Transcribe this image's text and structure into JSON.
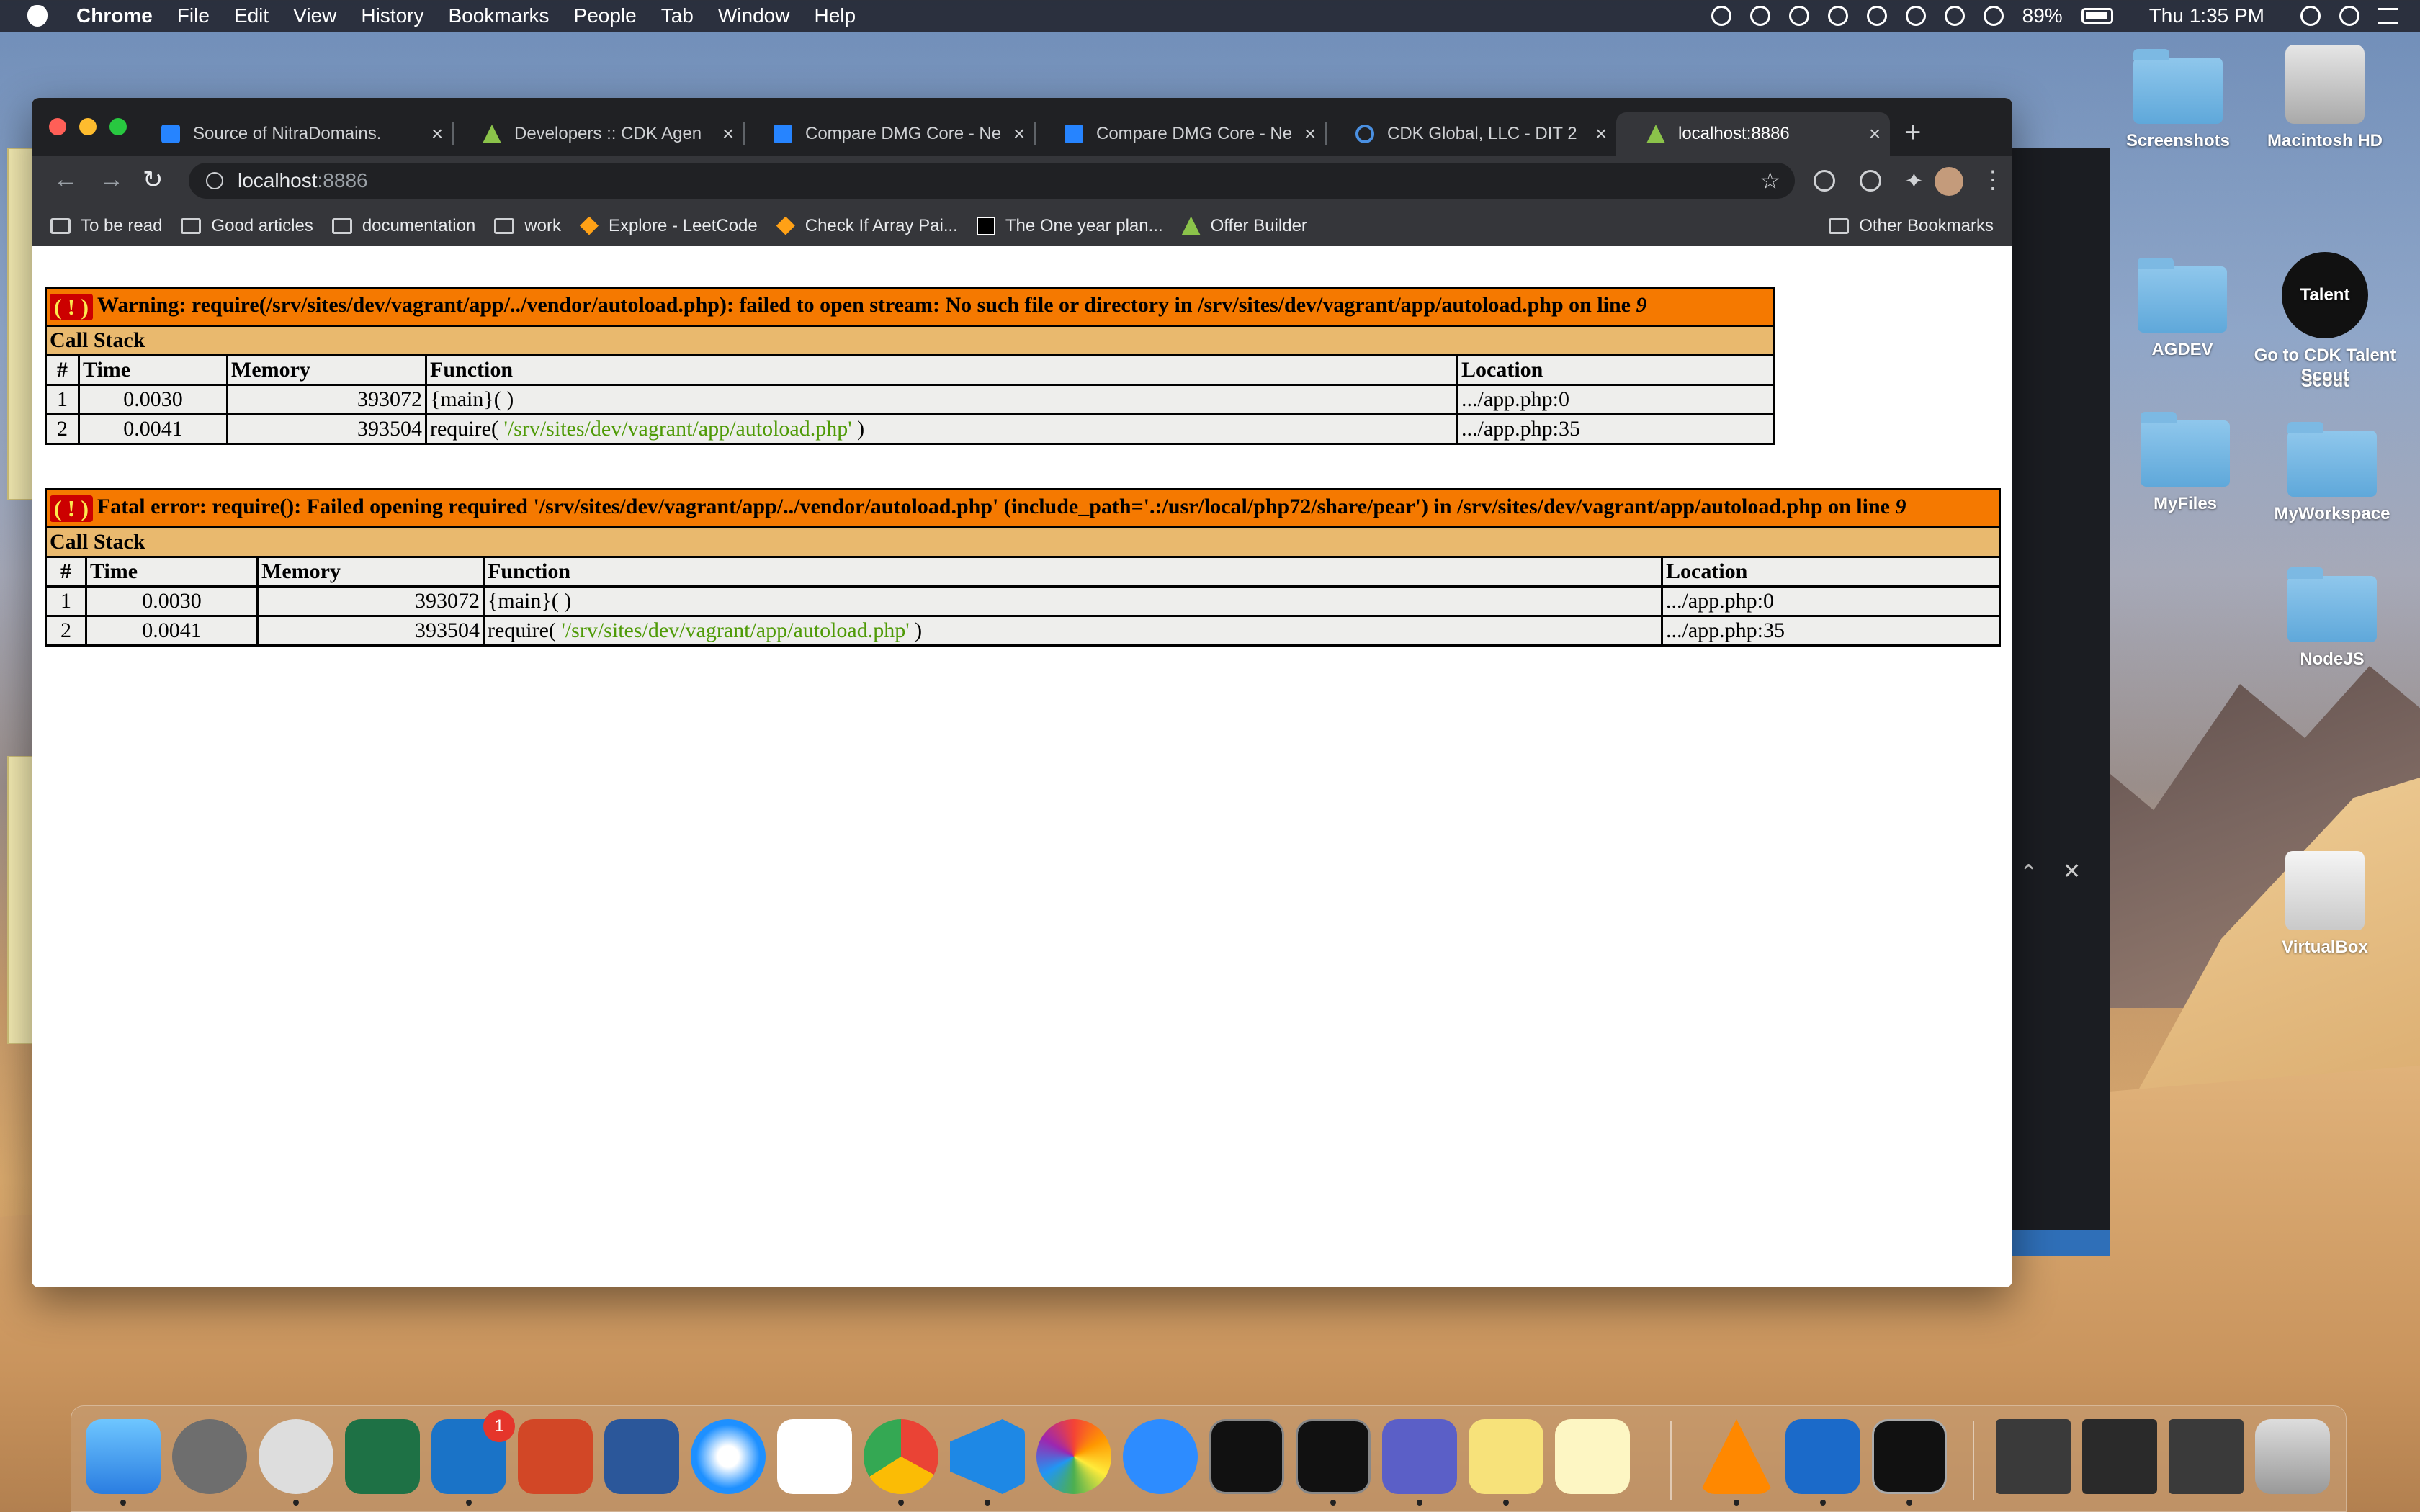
{
  "menubar": {
    "app": "Chrome",
    "items": [
      "File",
      "Edit",
      "View",
      "History",
      "Bookmarks",
      "People",
      "Tab",
      "Window",
      "Help"
    ],
    "battery": "89%",
    "clock": "Thu 1:35 PM"
  },
  "tabs": [
    {
      "title": "Source of NitraDomains.",
      "icon": "bitbucket-icon"
    },
    {
      "title": "Developers :: CDK Agen",
      "icon": "cdk-triangle-icon"
    },
    {
      "title": "Compare DMG Core - Ne",
      "icon": "bitbucket-icon"
    },
    {
      "title": "Compare DMG Core - Ne",
      "icon": "bitbucket-icon"
    },
    {
      "title": "CDK Global, LLC - DIT 2",
      "icon": "circle-icon"
    },
    {
      "title": "localhost:8886",
      "icon": "cdk-triangle-icon",
      "active": true
    }
  ],
  "toolbar": {
    "url_host": "localhost",
    "url_port": ":8886"
  },
  "bookmarks": {
    "items": [
      "To be read",
      "Good articles",
      "documentation",
      "work",
      "Explore - LeetCode",
      "Check If Array Pai...",
      "The One year plan...",
      "Offer Builder"
    ],
    "other": "Other Bookmarks"
  },
  "errors": [
    {
      "type": "Warning",
      "message": "Warning: require(/srv/sites/dev/vagrant/app/../vendor/autoload.php): failed to open stream: No such file or directory in /srv/sites/dev/vagrant/app/autoload.php on line",
      "line": "9",
      "call_stack_label": "Call Stack",
      "headers": [
        "#",
        "Time",
        "Memory",
        "Function",
        "Location"
      ],
      "rows": [
        {
          "num": "1",
          "time": "0.0030",
          "memory": "393072",
          "func": "{main}( )",
          "arg": "",
          "func_end": "",
          "location": ".../app.php:0"
        },
        {
          "num": "2",
          "time": "0.0041",
          "memory": "393504",
          "func": "require(",
          "arg": "'/srv/sites/dev/vagrant/app/autoload.php'",
          "func_end": ")",
          "location": ".../app.php:35"
        }
      ]
    },
    {
      "type": "Fatal error",
      "message": "Fatal error: require(): Failed opening required '/srv/sites/dev/vagrant/app/../vendor/autoload.php' (include_path='.:/usr/local/php72/share/pear') in /srv/sites/dev/vagrant/app/autoload.php on line",
      "line": "9",
      "call_stack_label": "Call Stack",
      "headers": [
        "#",
        "Time",
        "Memory",
        "Function",
        "Location"
      ],
      "rows": [
        {
          "num": "1",
          "time": "0.0030",
          "memory": "393072",
          "func": "{main}( )",
          "arg": "",
          "func_end": "",
          "location": ".../app.php:0"
        },
        {
          "num": "2",
          "time": "0.0041",
          "memory": "393504",
          "func": "require(",
          "arg": "'/srv/sites/dev/vagrant/app/autoload.php'",
          "func_end": ")",
          "location": ".../app.php:35"
        }
      ]
    }
  ],
  "desktop": {
    "icons": [
      "Screenshots",
      "Macintosh HD",
      "AGDEV",
      "Go to CDK Talent Scout",
      "MyFiles",
      "MyWorkspace",
      "NodeJS",
      "VirtualBox"
    ],
    "talent_logo": "Talent Scout"
  },
  "dock": {
    "outlook_badge": "1",
    "apps": [
      "finder-icon",
      "system-preferences-icon",
      "vpn-icon",
      "excel-icon",
      "outlook-icon",
      "powerpoint-icon",
      "word-icon",
      "safari-icon",
      "cdk-global-icon",
      "chrome-icon",
      "vscode-icon",
      "photos-icon",
      "zoom-icon",
      "activity-monitor-icon",
      "terminal-icon",
      "teams-icon",
      "stickies-icon",
      "notes-icon",
      "vlc-icon",
      "virtualbox-icon",
      "display-icon"
    ]
  },
  "colors": {
    "xdebug_header": "#f57900",
    "xdebug_callstack": "#e9b96e",
    "xdebug_row": "#eeeeec",
    "xdebug_string": "#4e9a06"
  }
}
